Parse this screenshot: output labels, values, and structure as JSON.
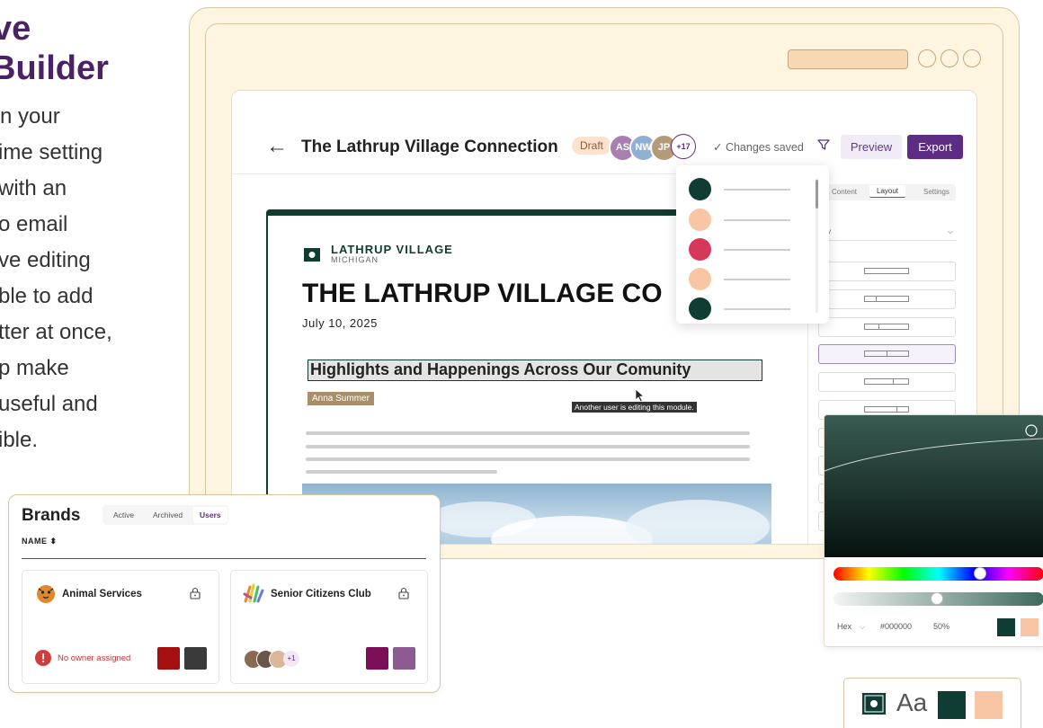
{
  "hero": {
    "title_line1": "ve",
    "title_line2": "Builder",
    "body_lines": [
      "n your",
      "ime setting",
      "with an",
      "o email",
      "ve editing",
      "ble to add",
      "tter at once,",
      "p make",
      "useful and",
      "ible."
    ]
  },
  "editor": {
    "title": "The Lathrup Village Connection",
    "status_badge": "Draft",
    "collaborators": [
      {
        "initials": "AS",
        "color": "#a77fb0"
      },
      {
        "initials": "NW",
        "color": "#8fb0d2"
      },
      {
        "initials": "JP",
        "color": "#b39a78"
      }
    ],
    "collaborators_more": "+17",
    "saved_status": "✓  Changes saved",
    "preview_label": "Preview",
    "export_label": "Export",
    "colors": {
      "brand": "#5c2d82",
      "dark_green": "#0f3d33",
      "peach": "#f8c6a5",
      "rose": "#d7375a"
    }
  },
  "newsletter": {
    "brand": "LATHRUP VILLAGE",
    "brand_sub": "MICHIGAN",
    "headline": "THE LATHRUP VILLAGE CO",
    "date": "July 10, 2025",
    "highlight_title": "Highlights and Happenings Across Our Comunity",
    "author_tag": "Anna Summer",
    "editing_tooltip": "Another user is editing this module."
  },
  "swatch_popup": {
    "swatches": [
      "#0f3d33",
      "#f8c6a5",
      "#d7375a",
      "#f8c6a5",
      "#0f3d33"
    ]
  },
  "right_panel": {
    "tabs": [
      "Content",
      "Layout",
      "Settings"
    ],
    "active_tab": "Layout",
    "section_label": "s",
    "select_value": "npty",
    "select_chevron": "⌵"
  },
  "color_picker": {
    "format_label": "Hex",
    "hex_value": "#000000",
    "opacity_value": "50%",
    "hue_position": 0.71,
    "alpha_position": 0.49,
    "recent_swatches": [
      "#0f3d33",
      "#f8c6a5"
    ]
  },
  "brand_strip": {
    "font_sample": "Aa",
    "swatches": [
      "#0f3d33",
      "#f8c6a5"
    ]
  },
  "brands": {
    "title": "Brands",
    "tabs": [
      "Active",
      "Archived",
      "Users"
    ],
    "active_tab": "Users",
    "column_header": "NAME ⬍",
    "cards": [
      {
        "name": "Animal Services",
        "icon": "tiger-icon",
        "warning": "No owner assigned",
        "swatches": [
          "#a50f0f",
          "#3a3a3a"
        ]
      },
      {
        "name": "Senior Citizens Club",
        "icon": "hands-icon",
        "owners_more": "+1",
        "swatches": [
          "#7a0e57",
          "#8e5a92"
        ]
      }
    ]
  }
}
